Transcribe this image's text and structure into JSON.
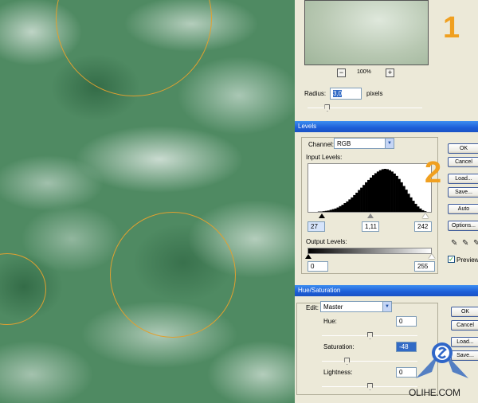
{
  "annotations": {
    "step1": "1",
    "step2": "2"
  },
  "blur": {
    "zoom_out": "−",
    "zoom_in": "+",
    "zoom": "100%",
    "radius_label": "Radius:",
    "radius_value": "3,0",
    "radius_unit": "pixels",
    "radius_slider_fraction": 0.17
  },
  "levels": {
    "title": "Levels",
    "channel_label": "Channel:",
    "channel_value": "RGB",
    "input_label": "Input Levels:",
    "input_values": [
      "27",
      "1,11",
      "242"
    ],
    "output_label": "Output Levels:",
    "output_values": [
      "0",
      "255"
    ],
    "buttons": [
      "OK",
      "Cancel",
      "Load...",
      "Save...",
      "Auto",
      "Options..."
    ],
    "preview_label": "Preview",
    "preview_checked": true,
    "histogram": [
      0,
      0,
      0,
      0,
      1,
      1,
      2,
      3,
      4,
      6,
      8,
      10,
      13,
      17,
      21,
      26,
      31,
      37,
      43,
      50,
      57,
      65,
      72,
      80,
      88,
      95,
      102,
      109,
      115,
      120,
      124,
      127,
      128,
      127,
      124,
      120,
      114,
      107,
      98,
      88,
      77,
      66,
      54,
      43,
      33,
      24,
      16,
      10,
      5,
      2,
      0,
      0
    ]
  },
  "hue_saturation": {
    "title": "Hue/Saturation",
    "edit_label": "Edit:",
    "edit_value": "Master",
    "hue_label": "Hue:",
    "hue_value": "0",
    "saturation_label": "Saturation:",
    "saturation_value": "-48",
    "lightness_label": "Lightness:",
    "lightness_value": "0",
    "buttons": [
      "OK",
      "Cancel",
      "Load...",
      "Save..."
    ]
  },
  "watermark": "OLIHE.COM",
  "colors": {
    "accent": "#f0a020",
    "circle": "#e0a030",
    "titlebar": "#1d5ed8"
  }
}
